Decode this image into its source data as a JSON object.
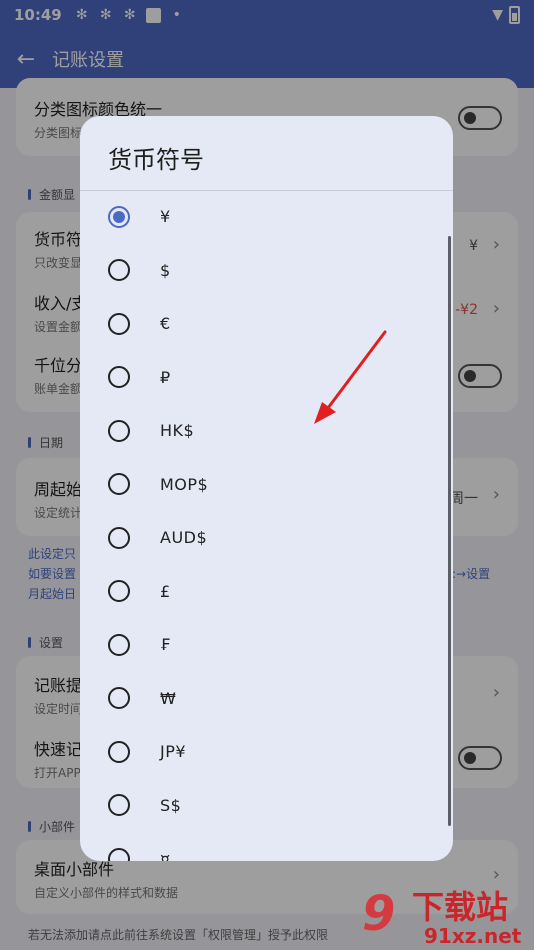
{
  "status_bar": {
    "time": "10:49"
  },
  "app_bar": {
    "title": "记账设置"
  },
  "background": {
    "row_category_color": {
      "title": "分类图标颜色统一",
      "subtitle": "分类图标"
    },
    "section_amount": "金额显",
    "row_currency": {
      "title": "货币符",
      "subtitle": "只改变显",
      "value": "¥"
    },
    "row_income": {
      "title": "收入/支",
      "subtitle": "设置金额",
      "value": "-¥2"
    },
    "row_thousands": {
      "title": "千位分",
      "subtitle": "账单金额"
    },
    "section_date": "日期",
    "row_week_start": {
      "title": "周起始",
      "subtitle": "设定统计",
      "value": "周一"
    },
    "note_line1": "此设定只",
    "note_line2_left": "如要设置",
    "note_line2_right": ":→设置",
    "note_line3": "月起始日",
    "section_settings": "设置",
    "row_reminder": {
      "title": "记账提",
      "subtitle": "设定时间"
    },
    "row_quick": {
      "title": "快速记",
      "subtitle": "打开APP"
    },
    "section_widget": "小部件",
    "row_widget": {
      "title": "桌面小部件",
      "subtitle": "自定义小部件的样式和数据"
    },
    "footnote": "若无法添加请点此前往系统设置「权限管理」授予此权限"
  },
  "dialog": {
    "title": "货币符号",
    "options": [
      {
        "label": "¥",
        "selected": true
      },
      {
        "label": "$",
        "selected": false
      },
      {
        "label": "€",
        "selected": false
      },
      {
        "label": "₽",
        "selected": false
      },
      {
        "label": "HK$",
        "selected": false
      },
      {
        "label": "MOP$",
        "selected": false
      },
      {
        "label": "AUD$",
        "selected": false
      },
      {
        "label": "£",
        "selected": false
      },
      {
        "label": "₣",
        "selected": false
      },
      {
        "label": "₩",
        "selected": false
      },
      {
        "label": "JP¥",
        "selected": false
      },
      {
        "label": "S$",
        "selected": false
      },
      {
        "label": "¤",
        "selected": false
      }
    ]
  },
  "watermark": {
    "text_big": "下载站",
    "text_small": "91xz.net",
    "logo": "9"
  },
  "colors": {
    "primary": "#4e69c5",
    "dialog_bg": "#e5e9f5",
    "arrow": "#e02020",
    "watermark": "#c9262b"
  }
}
